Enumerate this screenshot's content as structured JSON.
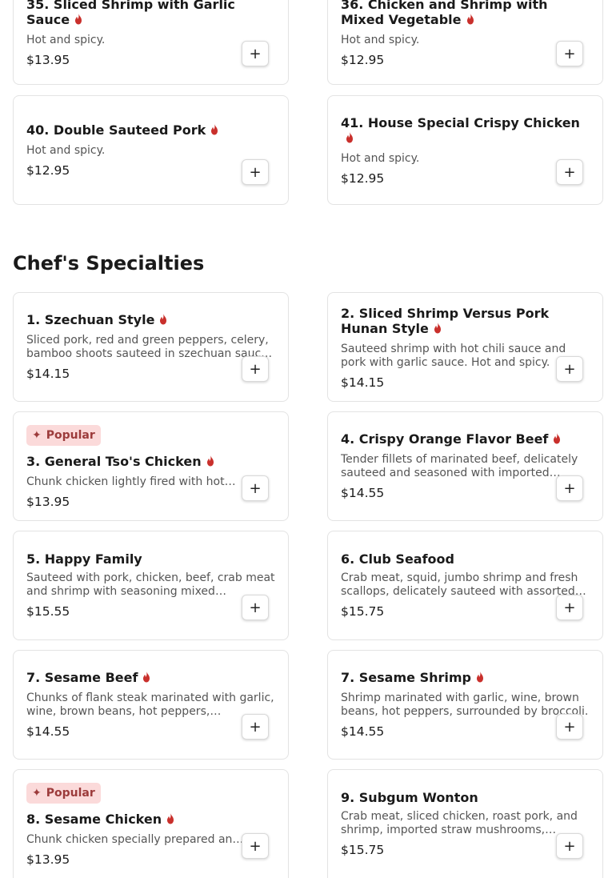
{
  "flame_color": "#c9302c",
  "add_label": "+",
  "badge_label": "Popular",
  "top_items": [
    {
      "title": "35. Sliced Shrimp with Garlic Sauce",
      "desc": "Hot and spicy.",
      "price": "$13.95"
    },
    {
      "title": "36. Chicken and Shrimp with Mixed Vegetable",
      "desc": "Hot and spicy.",
      "price": "$12.95"
    },
    {
      "title": "40. Double Sauteed Pork",
      "desc": "Hot and spicy.",
      "price": "$12.95"
    },
    {
      "title": "41. House Special Crispy Chicken",
      "desc": "Hot and spicy.",
      "price": "$12.95"
    }
  ],
  "section": {
    "title": "Chef's Specialties"
  },
  "items": [
    {
      "title": "1. Szechuan Style",
      "desc": "Sliced pork, red and green peppers, celery, bamboo shoots sauteed in szechuan sauce. Hot and spicy.",
      "price": "$14.15"
    },
    {
      "title": "2. Sliced Shrimp Versus Pork Hunan Style",
      "desc": "Sauteed shrimp with hot chili sauce and pork with garlic sauce. Hot and spicy.",
      "price": "$14.15"
    },
    {
      "title": "3. General Tso's Chicken",
      "desc": "Chunk chicken lightly fired with hot bean sauce.",
      "price": "$13.95"
    },
    {
      "title": "4. Crispy Orange Flavor Beef",
      "desc": "Tender fillets of marinated beef, delicately sauteed and seasoned with imported orange peel.",
      "price": "$14.55"
    },
    {
      "title": "5. Happy Family",
      "desc": "Sauteed with pork, chicken, beef, crab meat and shrimp with seasoning mixed vegetables.",
      "price": "$15.55"
    },
    {
      "title": "6. Club Seafood",
      "desc": "Crab meat, squid, jumbo shrimp and fresh scallops, delicately sauteed with assorted vegetables.",
      "price": "$15.75"
    },
    {
      "title": "7. Sesame Beef",
      "desc": "Chunks of flank steak marinated with garlic, wine, brown beans, hot peppers, surrounded by broccoli.",
      "price": "$14.55"
    },
    {
      "title": "7. Sesame Shrimp",
      "desc": "Shrimp marinated with garlic, wine, brown beans, hot peppers, surrounded by broccoli.",
      "price": "$14.55"
    },
    {
      "title": "8. Sesame Chicken",
      "desc": "Chunk chicken specially prepared and sauteed.",
      "price": "$13.95"
    },
    {
      "title": "9. Subgum Wonton",
      "desc": "Crab meat, sliced chicken, roast pork, and shrimp, imported straw mushrooms, vegetables.",
      "price": "$15.75"
    }
  ]
}
